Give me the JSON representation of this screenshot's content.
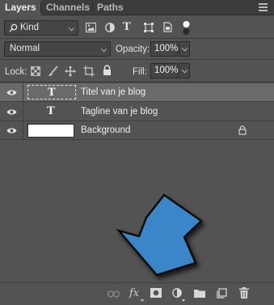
{
  "tabs": [
    {
      "label": "Layers",
      "active": true
    },
    {
      "label": "Channels",
      "active": false
    },
    {
      "label": "Paths",
      "active": false
    }
  ],
  "filter": {
    "kind_label": "Kind",
    "filter_icons": [
      "image-filter-icon",
      "adjustment-filter-icon",
      "type-filter-icon",
      "shape-filter-icon",
      "smart-object-filter-icon",
      "filter-toggle-icon"
    ]
  },
  "blend": {
    "mode": "Normal",
    "opacity_label": "Opacity:",
    "opacity_value": "100%"
  },
  "lock": {
    "label": "Lock:",
    "fill_label": "Fill:",
    "fill_value": "100%"
  },
  "layers": [
    {
      "name": "Titel van je blog",
      "type": "text",
      "selected": true
    },
    {
      "name": "Tagline van je blog",
      "type": "text",
      "selected": false
    },
    {
      "name": "Background",
      "type": "image",
      "selected": false,
      "locked": true
    }
  ],
  "bottom_bar": {
    "fx_label": "fx"
  },
  "colors": {
    "panel_bg": "#535353",
    "selected_row": "#6a6a6a",
    "arrow_fill": "#3a86c8"
  }
}
